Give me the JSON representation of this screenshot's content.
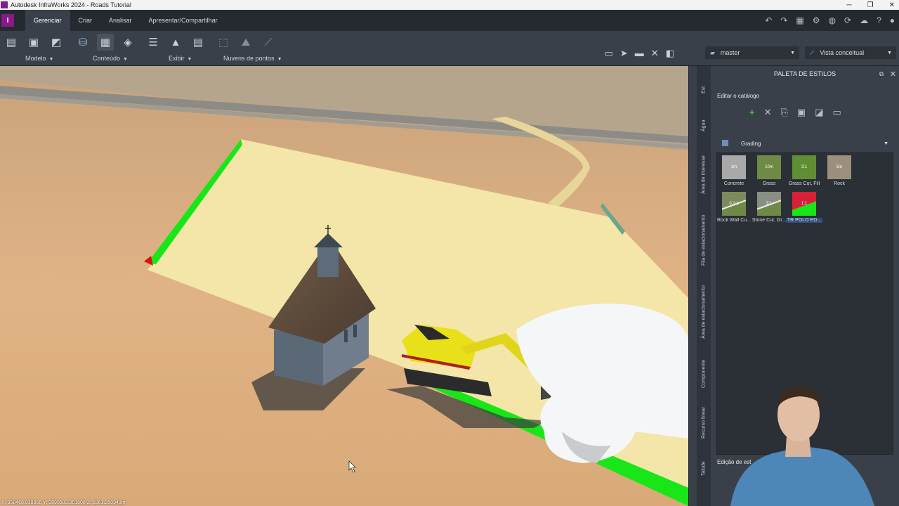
{
  "window": {
    "title": "Autodesk InfraWorks 2024 - Roads Tutorial",
    "app_letter": "I"
  },
  "ribbon": {
    "tabs": [
      "Gerenciar",
      "Criar",
      "Analisar",
      "Apresentar/Compartilhar"
    ],
    "active_tab": "Gerenciar",
    "groups": {
      "modelo": "Modelo",
      "conteudo": "Conteúdo",
      "exibir": "Exibir",
      "nuvens": "Nuvens de pontos"
    },
    "proposal": "master",
    "visual_style": "Vista conceitual"
  },
  "viewport": {
    "coordinates": "X: 358468.938856 Y: 3890582.361808 Z: 1861.250948m"
  },
  "palette": {
    "title": "PALETA DE ESTILOS",
    "edit_catalog": "Editar o catálogo",
    "category": "Grading",
    "bottom_label": "Edição de est",
    "side_tabs": [
      "Est",
      "Água",
      "Área de interesse",
      "Fila de estacionamento",
      "Área de estacionamento",
      "Componente",
      "Recurso linear",
      "Talude"
    ],
    "styles": [
      {
        "name": "Concrete",
        "tag": "1m",
        "color": "#a9a9a9"
      },
      {
        "name": "Grass",
        "tag": "10m",
        "color": "#6e8a45"
      },
      {
        "name": "Grass Cut, Fill",
        "tag": "3:1",
        "color": "#5f8e33"
      },
      {
        "name": "Rock",
        "tag": "5m",
        "color": "#9c8f7c"
      },
      {
        "name": "Rock Wall Cu...",
        "tag": "0.1:1",
        "color": "#7d8a5c"
      },
      {
        "name": "Stone Cut, Gr...",
        "tag": "3:1",
        "color": "#8a8f86"
      },
      {
        "name": "TR POLO ED...",
        "tag": "1:1",
        "color": "#d8203a"
      }
    ]
  },
  "colors": {
    "grading_green": "#19e619",
    "pad_fill": "#f3e6a8",
    "panel_bg": "#3a4049",
    "accent_green": "#3fd13f"
  }
}
